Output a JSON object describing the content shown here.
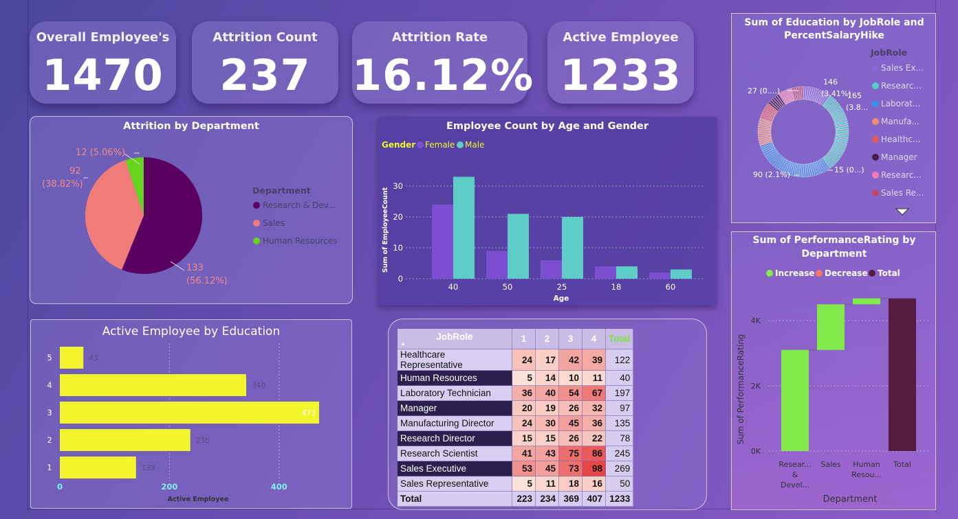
{
  "kpis": [
    {
      "title": "Overall Employee's",
      "value": "1470"
    },
    {
      "title": "Attrition Count",
      "value": "237"
    },
    {
      "title": "Attrition Rate",
      "value": "16.12%"
    },
    {
      "title": "Active Employee",
      "value": "1233"
    }
  ],
  "pie": {
    "title": "Attrition by Department",
    "legend_title": "Department",
    "labels": {
      "hr": "12 (5.06%)",
      "sales_a": "92",
      "sales_b": "(38.82%)",
      "rd_a": "133",
      "rd_b": "(56.12%)"
    },
    "legend": [
      "Research & Dev...",
      "Sales",
      "Human Resources"
    ]
  },
  "age": {
    "title": "Employee Count by Age and Gender",
    "legend_title": "Gender",
    "female": "Female",
    "male": "Male",
    "ylabel": "Sum of EmployeeCount",
    "xlabel": "Age",
    "ticks": [
      "0",
      "10",
      "20",
      "30"
    ]
  },
  "donut": {
    "title_line1": "Sum of Education by JobRole and",
    "title_line2": "PercentSalaryHike",
    "legend_title": "JobRole",
    "legend": [
      "Sales Ex...",
      "Researc...",
      "Laborat...",
      "Manufa...",
      "Healthc...",
      "Manager",
      "Researc...",
      "Sales Re..."
    ],
    "labels": {
      "l146a": "146",
      "l146b": "(3.41%)",
      "l165a": "165",
      "l165b": "(3.8...",
      "l27": "27 (0....)",
      "l90": "90 (2.1%)",
      "l15": "15 (0...)"
    }
  },
  "edu": {
    "title": "Active Employee by Education",
    "xlabel": "Active Employee",
    "xticks": [
      "0",
      "200",
      "400"
    ]
  },
  "matrix": {
    "header": "JobRole",
    "cols": [
      "1",
      "2",
      "3",
      "4"
    ],
    "total_label": "Total",
    "rows": [
      {
        "role": "Healthcare Representative",
        "vals": [
          "24",
          "17",
          "42",
          "39"
        ],
        "total": "122"
      },
      {
        "role": "Human Resources",
        "vals": [
          "5",
          "14",
          "10",
          "11"
        ],
        "total": "40"
      },
      {
        "role": "Laboratory Technician",
        "vals": [
          "36",
          "40",
          "54",
          "67"
        ],
        "total": "197"
      },
      {
        "role": "Manager",
        "vals": [
          "20",
          "19",
          "26",
          "32"
        ],
        "total": "97"
      },
      {
        "role": "Manufacturing Director",
        "vals": [
          "24",
          "30",
          "45",
          "36"
        ],
        "total": "135"
      },
      {
        "role": "Research Director",
        "vals": [
          "15",
          "15",
          "26",
          "22"
        ],
        "total": "78"
      },
      {
        "role": "Research Scientist",
        "vals": [
          "41",
          "43",
          "75",
          "86"
        ],
        "total": "245"
      },
      {
        "role": "Sales Executive",
        "vals": [
          "53",
          "45",
          "73",
          "98"
        ],
        "total": "269"
      },
      {
        "role": "Sales Representative",
        "vals": [
          "5",
          "11",
          "18",
          "16"
        ],
        "total": "50"
      }
    ],
    "totals": {
      "label": "Total",
      "vals": [
        "223",
        "234",
        "369",
        "407"
      ],
      "total": "1233"
    }
  },
  "waterfall": {
    "title_line1": "Sum of PerformanceRating by",
    "title_line2": "Department",
    "legend": [
      "Increase",
      "Decrease",
      "Total"
    ],
    "ylabel": "Sum of PerformanceRating",
    "xlabel": "Department",
    "yticks": [
      "0K",
      "2K",
      "4K"
    ],
    "xcats": [
      [
        "Resear...",
        "&",
        "Devel..."
      ],
      [
        "Sales"
      ],
      [
        "Human",
        "Resou..."
      ],
      [
        "Total"
      ]
    ]
  },
  "colors": {
    "female": "#7b4fd0",
    "male": "#5ecdc8",
    "rd": "#5a0060",
    "sales": "#f07c7a",
    "hr": "#66d31c",
    "edu_bar": "#f2f52c",
    "increase": "#80ea4a",
    "decrease": "#f37a6a",
    "total": "#541d3f"
  },
  "chart_data": [
    {
      "type": "pie",
      "title": "Attrition by Department",
      "categories": [
        "Research & Development",
        "Sales",
        "Human Resources"
      ],
      "values": [
        133,
        92,
        12
      ],
      "percents": [
        56.12,
        38.82,
        5.06
      ],
      "legend_placement": "right"
    },
    {
      "type": "bar",
      "title": "Employee Count by Age and Gender",
      "categories": [
        "40",
        "50",
        "25",
        "18",
        "60"
      ],
      "series": [
        {
          "name": "Female",
          "values": [
            24,
            9,
            6,
            4,
            2
          ]
        },
        {
          "name": "Male",
          "values": [
            33,
            21,
            20,
            4,
            3
          ]
        }
      ],
      "xlabel": "Age",
      "ylabel": "Sum of EmployeeCount",
      "ylim": [
        0,
        35
      ],
      "grid": true,
      "legend_placement": "top-left"
    },
    {
      "type": "bar",
      "title": "Active Employee by Education",
      "orientation": "horizontal",
      "categories": [
        "5",
        "4",
        "3",
        "2",
        "1"
      ],
      "values": [
        43,
        340,
        473,
        238,
        139
      ],
      "xlabel": "Active Employee",
      "xlim": [
        0,
        480
      ],
      "grid": true
    },
    {
      "type": "bar",
      "title": "Sum of PerformanceRating by Department",
      "subtype": "waterfall",
      "categories": [
        "Research & Development",
        "Sales",
        "Human Resources",
        "Total"
      ],
      "values": [
        3100,
        1400,
        180,
        4680
      ],
      "kinds": [
        "increase",
        "increase",
        "increase",
        "total"
      ],
      "ylabel": "Sum of PerformanceRating",
      "xlabel": "Department",
      "ylim": [
        0,
        4800
      ]
    },
    {
      "type": "pie",
      "subtype": "donut",
      "title": "Sum of Education by JobRole and PercentSalaryHike",
      "categories": [
        "Sales Executive",
        "Research Scientist",
        "Laboratory Technician",
        "Manufacturing Director",
        "Healthcare Representative",
        "Manager",
        "Research Director",
        "Sales Representative"
      ],
      "labeled_values": [
        {
          "label": "146 (3.41%)",
          "value": 146
        },
        {
          "label": "165 (3.8...",
          "value": 165
        },
        {
          "label": "27 (0....)",
          "value": 27
        },
        {
          "label": "90 (2.1%)",
          "value": 90
        },
        {
          "label": "15 (0...)",
          "value": 15
        }
      ]
    }
  ]
}
